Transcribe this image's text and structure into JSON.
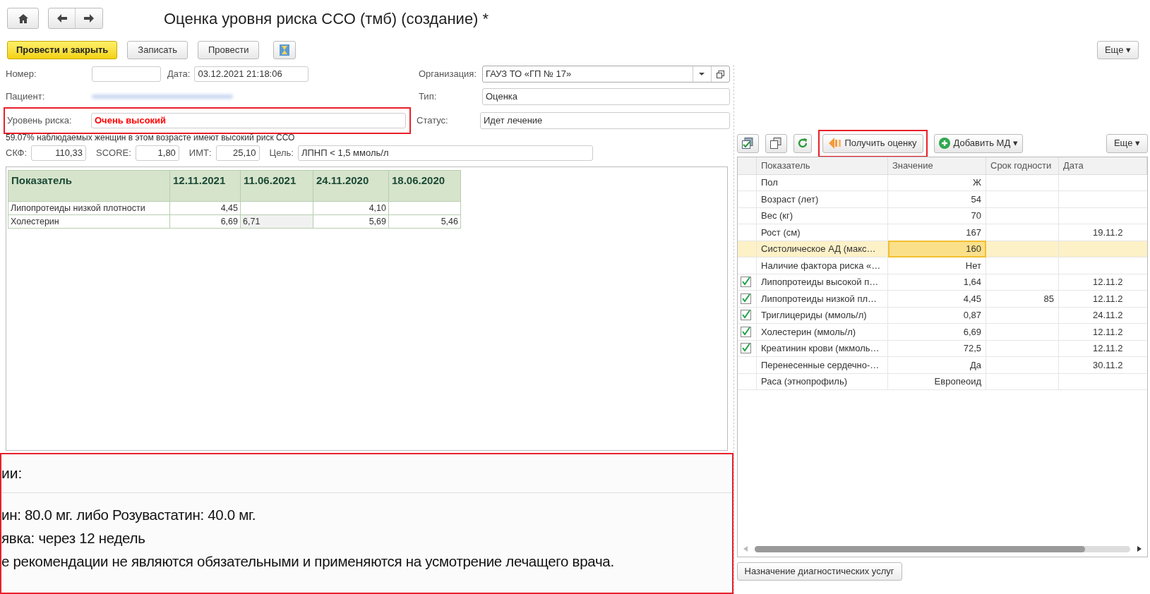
{
  "title": "Оценка уровня риска ССО (тмб) (создание) *",
  "toolbar": [
    {
      "label": "Провести и закрыть",
      "kind": "primary"
    },
    {
      "label": "Записать",
      "kind": "normal"
    },
    {
      "label": "Провести",
      "kind": "normal"
    },
    {
      "kind": "icon"
    }
  ],
  "more_button": "Еще ▾",
  "fields": {
    "number": {
      "label": "Номер:"
    },
    "date": {
      "label": "Дата:",
      "value": "03.12.2021 21:18:06"
    },
    "organization": {
      "label": "Организация:",
      "value": "ГАУЗ ТО «ГП № 17»"
    },
    "patient": {
      "label": "Пациент:"
    },
    "type": {
      "label": "Тип:",
      "value": "Оценка"
    },
    "risk": {
      "label": "Уровень риска:",
      "value": "Очень высокий",
      "highlighted": true
    },
    "status": {
      "label": "Статус:",
      "value": "Идет лечение"
    }
  },
  "note": "59.07% наблюдаемых женщин в этом возрасте имеют высокий риск ССО",
  "metrics": [
    {
      "label": "СКФ:",
      "value": "110,33"
    },
    {
      "label": "SCORE:",
      "value": "1,80"
    },
    {
      "label": "ИМТ:",
      "value": "25,10"
    },
    {
      "label": "Цель:",
      "value": "ЛПНП < 1,5 ммоль/л",
      "kind": "text"
    }
  ],
  "history_table": {
    "columns": [
      "Показатель",
      "12.11.2021",
      "11.06.2021",
      "24.11.2020",
      "18.06.2020"
    ],
    "rows": [
      {
        "cells": [
          {
            "text": "Липопротеиды низкой плотности",
            "selected": false
          },
          {
            "text": "4,45",
            "selected": false
          },
          {
            "selected": false
          },
          {
            "text": "4,10",
            "selected": false
          },
          {
            "selected": false
          }
        ]
      },
      {
        "cells": [
          {
            "text": "Холестерин",
            "selected": false
          },
          {
            "text": "6,69",
            "selected": false
          },
          {
            "text": "6,71",
            "selected": true
          },
          {
            "text": "5,69",
            "selected": false
          },
          {
            "text": "5,46",
            "selected": false
          }
        ]
      }
    ]
  },
  "recommendations": {
    "highlighted": true,
    "heading": "ии:",
    "lines": [
      "ин: 80.0 мг. либо Розувастатин: 40.0 мг.",
      "явка: через 12 недель",
      "е рекомендации не являются обязательными и применяются на усмотрение лечащего врача."
    ]
  },
  "panel_toolbar": [
    {
      "kind": "check-all"
    },
    {
      "kind": "copy"
    },
    {
      "kind": "refresh"
    },
    {
      "kind": "estimate",
      "label": "Получить оценку",
      "highlighted": true
    },
    {
      "kind": "add",
      "label": "Добавить МД ▾"
    }
  ],
  "panel_more": "Еще ▾",
  "indicators": {
    "columns": [
      "Показатель",
      "Значение",
      "Срок годности",
      "Дата"
    ],
    "rows": [
      {
        "checked": false,
        "selected": false,
        "name": "Пол",
        "value": "Ж"
      },
      {
        "checked": false,
        "selected": false,
        "name": "Возраст (лет)",
        "value": "54"
      },
      {
        "checked": false,
        "selected": false,
        "name": "Вес (кг)",
        "value": "70"
      },
      {
        "checked": false,
        "selected": false,
        "name": "Рост (см)",
        "value": "167",
        "date": "19.11.2"
      },
      {
        "checked": false,
        "selected": true,
        "name": "Систолическое АД (макс…",
        "value": "160"
      },
      {
        "checked": false,
        "selected": false,
        "name": "Наличие фактора риска «…",
        "value": "Нет"
      },
      {
        "checked": true,
        "selected": false,
        "name": "Липопротеиды высокой п…",
        "value": "1,64",
        "date": "12.11.2"
      },
      {
        "checked": true,
        "selected": false,
        "name": "Липопротеиды низкой пл…",
        "value": "4,45",
        "expiry": "85",
        "date": "12.11.2"
      },
      {
        "checked": true,
        "selected": false,
        "name": "Триглицериды (ммоль/л)",
        "value": "0,87",
        "date": "24.11.2"
      },
      {
        "checked": true,
        "selected": false,
        "name": "Холестерин (ммоль/л)",
        "value": "6,69",
        "date": "12.11.2"
      },
      {
        "checked": true,
        "selected": false,
        "name": "Креатинин крови (мкмоль…",
        "value": "72,5",
        "date": "12.11.2"
      },
      {
        "checked": false,
        "selected": false,
        "name": "Перенесенные сердечно-…",
        "value": "Да",
        "date": "30.11.2"
      },
      {
        "checked": false,
        "selected": false,
        "name": "Раса (этнопрофиль)",
        "value": "Европеоид"
      }
    ]
  },
  "bottom_button": "Назначение диагностических услуг"
}
